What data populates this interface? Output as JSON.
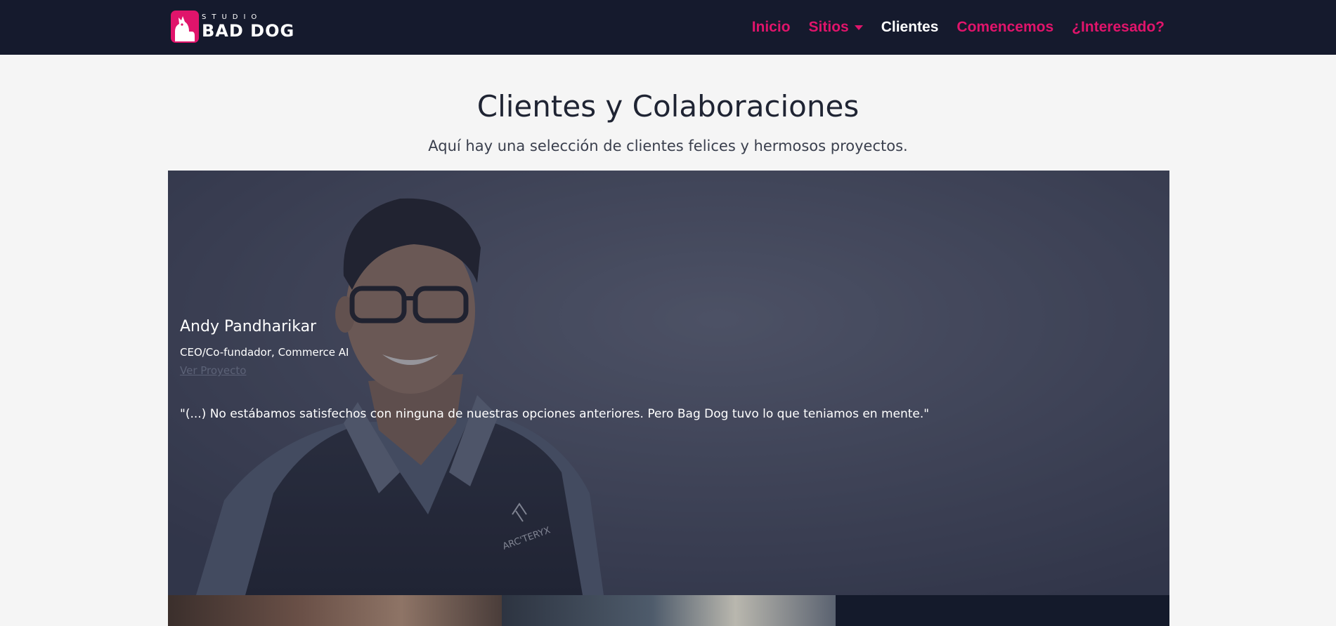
{
  "brand": {
    "studio": "STUDIO",
    "name": "BAD DOG",
    "accent_color": "#e0146b",
    "nav_bg": "#151a2d"
  },
  "nav": {
    "items": [
      {
        "label": "Inicio"
      },
      {
        "label": "Sitios"
      },
      {
        "label": "Clientes"
      },
      {
        "label": "Comencemos"
      },
      {
        "label": "¿Interesado?"
      }
    ]
  },
  "header": {
    "title": "Clientes y Colaboraciones",
    "subtitle": "Aquí hay una selección de clientes felices y hermosos proyectos."
  },
  "featured_client": {
    "name": "Andy Pandharikar",
    "role": "CEO/Co-fundador, Commerce AI",
    "link_label": "Ver Proyecto",
    "quote": "\"(...) No estábamos satisfechos con ninguna de nuestras opciones anteriores. Pero Bag Dog tuvo lo que teniamos en mente.\"",
    "jacket_logo": "ARC'TERYX"
  }
}
